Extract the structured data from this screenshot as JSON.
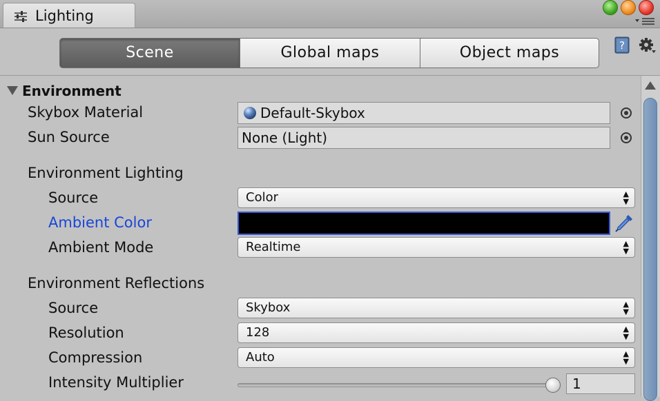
{
  "window": {
    "tab_title": "Lighting",
    "tab_icon": "lighting-sliders-icon",
    "window_controls": [
      "green-maximize",
      "orange-minimize",
      "red-close"
    ]
  },
  "toolbar": {
    "tabs": [
      {
        "label": "Scene",
        "selected": true
      },
      {
        "label": "Global maps",
        "selected": false
      },
      {
        "label": "Object maps",
        "selected": false
      }
    ],
    "icons": [
      "help-book-icon",
      "gear-icon"
    ]
  },
  "environment": {
    "header": "Environment",
    "skybox_material": {
      "label": "Skybox Material",
      "value": "Default-Skybox"
    },
    "sun_source": {
      "label": "Sun Source",
      "value": "None (Light)"
    },
    "lighting": {
      "header": "Environment Lighting",
      "source": {
        "label": "Source",
        "value": "Color"
      },
      "ambient_color": {
        "label": "Ambient Color",
        "value": "#000000"
      },
      "ambient_mode": {
        "label": "Ambient Mode",
        "value": "Realtime"
      }
    },
    "reflections": {
      "header": "Environment Reflections",
      "source": {
        "label": "Source",
        "value": "Skybox"
      },
      "resolution": {
        "label": "Resolution",
        "value": "128"
      },
      "compression": {
        "label": "Compression",
        "value": "Auto"
      },
      "intensity": {
        "label": "Intensity Multiplier",
        "value": "1",
        "slider_fraction": 1.0
      }
    }
  },
  "colors": {
    "accent_label": "#1846d8",
    "selected_tab": "#666666",
    "panel_bg": "#c2c2c2"
  }
}
